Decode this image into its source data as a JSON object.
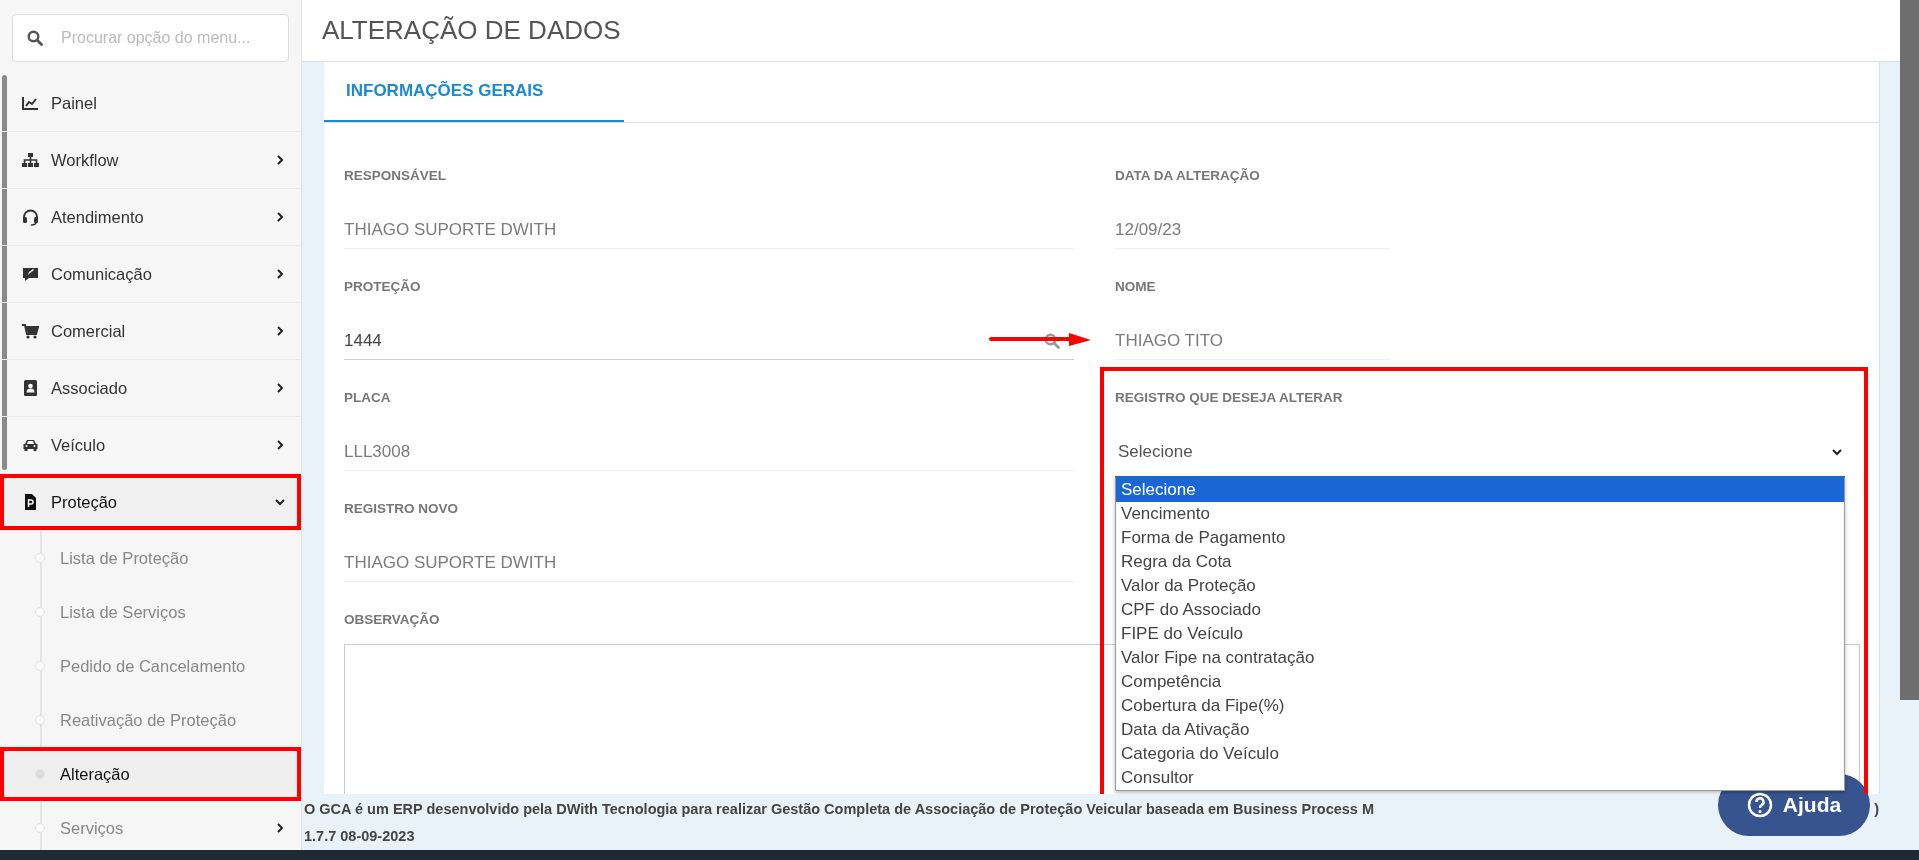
{
  "sidebar": {
    "search": {
      "placeholder": "Procurar opção do menu..."
    },
    "items": [
      {
        "label": "Painel"
      },
      {
        "label": "Workflow",
        "expanded": false
      },
      {
        "label": "Atendimento",
        "expanded": false
      },
      {
        "label": "Comunicação",
        "expanded": false
      },
      {
        "label": "Comercial",
        "expanded": false
      },
      {
        "label": "Associado",
        "expanded": false
      },
      {
        "label": "Veículo",
        "expanded": false
      },
      {
        "label": "Proteção",
        "expanded": true,
        "highlighted": true,
        "children": [
          {
            "label": "Lista de Proteção",
            "selected": false
          },
          {
            "label": "Lista de Serviços",
            "selected": false
          },
          {
            "label": "Pedido de Cancelamento",
            "selected": false
          },
          {
            "label": "Reativação de Proteção",
            "selected": false
          },
          {
            "label": "Alteração",
            "selected": true,
            "highlighted": true
          },
          {
            "label": "Serviços",
            "selected": false,
            "expanded": false
          }
        ]
      }
    ]
  },
  "page": {
    "title": "ALTERAÇÃO DE DADOS"
  },
  "tabs": [
    {
      "label": "INFORMAÇÕES GERAIS",
      "selected": true
    }
  ],
  "form": {
    "left_column": [
      {
        "kind": "display",
        "label": "RESPONSÁVEL",
        "value": "THIAGO SUPORTE DWITH"
      },
      {
        "kind": "search",
        "label": "PROTEÇÃO",
        "value": "1444",
        "pointer_arrow": true
      },
      {
        "kind": "display",
        "label": "PLACA",
        "value": "LLL3008"
      },
      {
        "kind": "display",
        "label": "REGISTRO NOVO",
        "value": "THIAGO SUPORTE DWITH"
      },
      {
        "kind": "textarea",
        "label": "OBSERVAÇÃO"
      }
    ],
    "right_column": [
      {
        "kind": "display",
        "label": "DATA DA ALTERAÇÃO",
        "value": "12/09/23"
      },
      {
        "kind": "display",
        "label": "NOME",
        "value": "THIAGO TITO"
      },
      {
        "kind": "select",
        "label": "REGISTRO QUE DESEJA ALTERAR",
        "value": "Selecione",
        "expanded": true,
        "highlighted": true,
        "options": [
          {
            "label": "Selecione",
            "selected": true
          },
          {
            "label": "Vencimento",
            "selected": false
          },
          {
            "label": "Forma de Pagamento",
            "selected": false
          },
          {
            "label": "Regra da Cota",
            "selected": false
          },
          {
            "label": "Valor da Proteção",
            "selected": false
          },
          {
            "label": "CPF do Associado",
            "selected": false
          },
          {
            "label": "FIPE do Veículo",
            "selected": false
          },
          {
            "label": "Valor Fipe na contratação",
            "selected": false
          },
          {
            "label": "Competência",
            "selected": false
          },
          {
            "label": "Cobertura da Fipe(%)",
            "selected": false
          },
          {
            "label": "Data da Ativação",
            "selected": false
          },
          {
            "label": "Categoria do Veículo",
            "selected": false
          },
          {
            "label": "Consultor",
            "selected": false
          }
        ]
      }
    ]
  },
  "footer": {
    "text": "O GCA é um ERP desenvolvido pela DWith Tecnologia para realizar Gestão Completa de Associação de Proteção Veicular baseada em Business Process M",
    "tail": ")",
    "version": "1.7.7 08-09-2023"
  },
  "help_button": {
    "label": "Ajuda"
  }
}
